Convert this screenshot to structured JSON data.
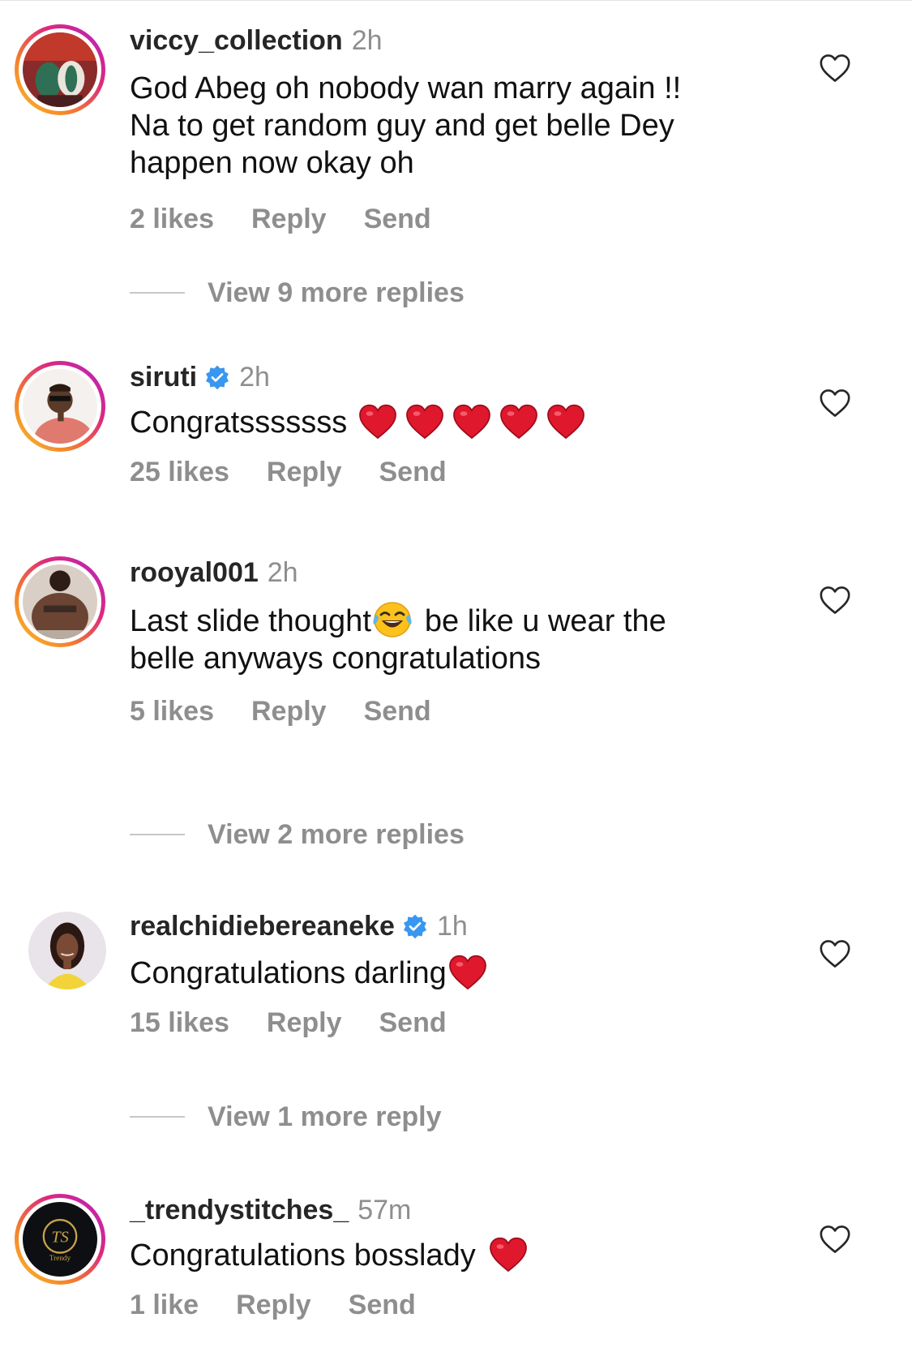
{
  "comments": [
    {
      "username": "viccy_collection",
      "verified": false,
      "time": "2h",
      "text_lines": [
        "God Abeg oh nobody wan marry again !!",
        "Na to get random guy and get belle Dey",
        "happen now okay oh"
      ],
      "likes": "2 likes",
      "reply": "Reply",
      "send": "Send",
      "view_replies": "View 9 more replies"
    },
    {
      "username": "siruti",
      "verified": true,
      "time": "2h",
      "text": "Congratsssssss",
      "emoji": [
        "red-heart",
        "red-heart",
        "red-heart",
        "red-heart",
        "red-heart"
      ],
      "likes": "25 likes",
      "reply": "Reply",
      "send": "Send"
    },
    {
      "username": "rooyal001",
      "verified": false,
      "time": "2h",
      "text_part1": "Last slide thought",
      "text_part2": "be like u wear the",
      "text_line2": "belle anyways congratulations",
      "emoji": [
        "face-with-tears-of-joy"
      ],
      "likes": "5 likes",
      "reply": "Reply",
      "send": "Send",
      "view_replies": "View 2 more replies"
    },
    {
      "username": "realchidiebereaneke",
      "verified": true,
      "time": "1h",
      "text": "Congratulations darling",
      "emoji": [
        "red-heart"
      ],
      "likes": "15 likes",
      "reply": "Reply",
      "send": "Send",
      "view_replies": "View 1 more reply"
    },
    {
      "username": "_trendystitches_",
      "verified": false,
      "time": "57m",
      "text": "Congratulations bosslady",
      "emoji": [
        "red-heart"
      ],
      "likes": "1 like",
      "reply": "Reply",
      "send": "Send",
      "avatar_text": "Trendy"
    }
  ],
  "colors": {
    "username": "#262626",
    "secondary": "#8e8e8e",
    "verified": "#3897f0",
    "heart": "#e0182d"
  }
}
